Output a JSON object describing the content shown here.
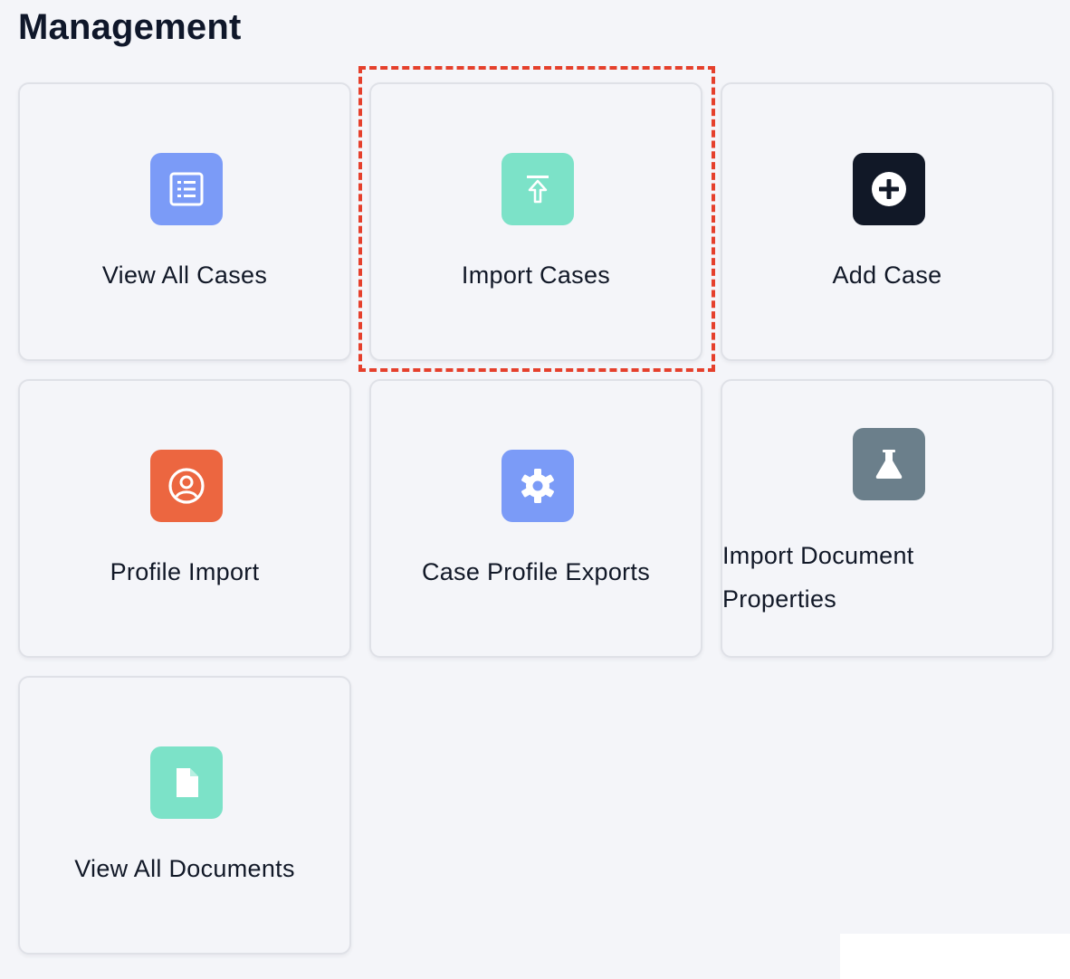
{
  "page": {
    "title": "Management"
  },
  "cards": [
    {
      "label": "View All Cases",
      "icon": "list-icon",
      "color": "#7b9bf7"
    },
    {
      "label": "Import Cases",
      "icon": "upload-icon",
      "color": "#7ce2c8"
    },
    {
      "label": "Add Case",
      "icon": "plus-circle-icon",
      "color": "#111827"
    },
    {
      "label": "Profile Import",
      "icon": "user-circle-icon",
      "color": "#ec6640"
    },
    {
      "label": "Case Profile Exports",
      "icon": "gear-icon",
      "color": "#7b9bf7"
    },
    {
      "label": "Import Document Properties",
      "icon": "flask-icon",
      "color": "#6b7f8b"
    },
    {
      "label": "View All Documents",
      "icon": "document-icon",
      "color": "#7ce2c8"
    }
  ],
  "highlight": {
    "target": "Import Cases",
    "color": "#e5402c"
  }
}
